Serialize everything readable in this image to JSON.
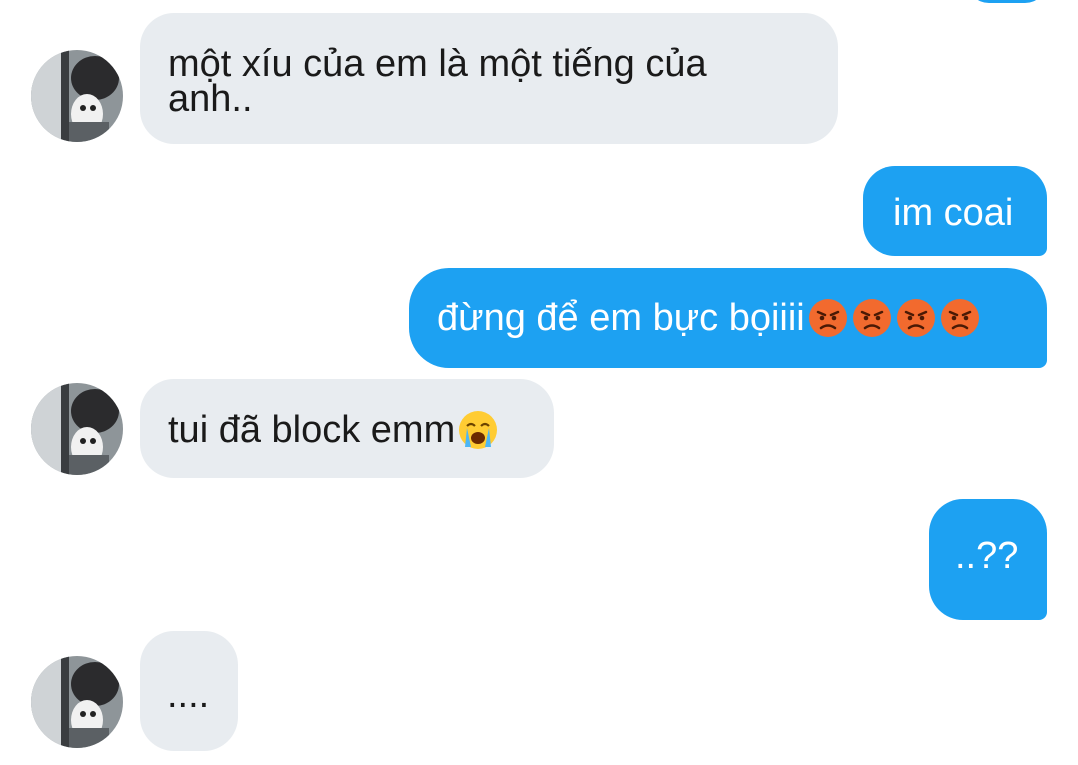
{
  "colors": {
    "incoming_bubble": "#e8ecf0",
    "outgoing_bubble": "#1da1f2",
    "incoming_text": "#1a1a1a",
    "outgoing_text": "#ffffff"
  },
  "messages": [
    {
      "direction": "incoming",
      "text_line1": "một xíu của em là một tiếng của",
      "text_line2": "anh..",
      "emoji": []
    },
    {
      "direction": "outgoing",
      "text": "im coai",
      "emoji": []
    },
    {
      "direction": "outgoing",
      "text": "đừng để em bực bọiiii",
      "emoji": [
        "angry-face",
        "angry-face",
        "angry-face",
        "angry-face"
      ]
    },
    {
      "direction": "incoming",
      "text": "tui đã block emm",
      "emoji": [
        "crying-face"
      ]
    },
    {
      "direction": "outgoing",
      "text": "..??",
      "emoji": []
    },
    {
      "direction": "incoming",
      "text": "....",
      "emoji": []
    }
  ]
}
